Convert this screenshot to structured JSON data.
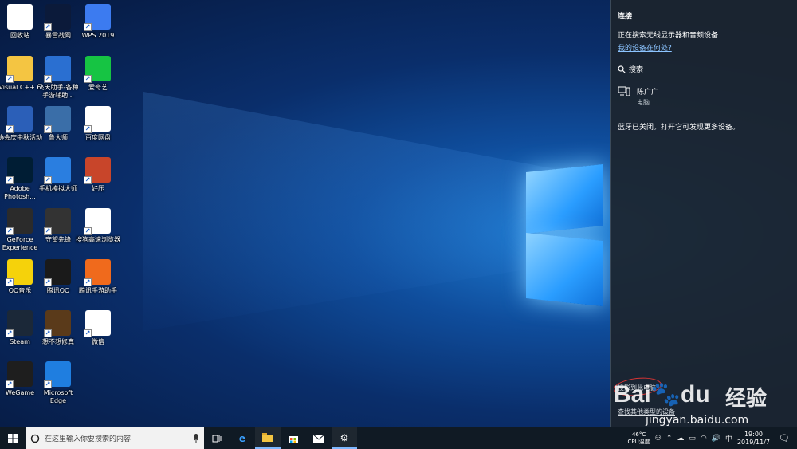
{
  "desktop": {
    "icons": [
      {
        "label": "回收站",
        "icon": "recycle-bin-icon",
        "color": "#ffffff"
      },
      {
        "label": "暴雪战网",
        "icon": "battlenet-icon",
        "color": "#0b1a3a"
      },
      {
        "label": "WPS 2019",
        "icon": "wps-icon",
        "color": "#3c7bf0"
      },
      {
        "label": "Visual C++ 6",
        "icon": "folder-icon",
        "color": "#f4c542"
      },
      {
        "label": "飞天助手-各种手游辅助...",
        "icon": "feitian-icon",
        "color": "#2a6fd1"
      },
      {
        "label": "爱奇艺",
        "icon": "iqiyi-icon",
        "color": "#16c443"
      },
      {
        "label": "协会庆中秋活动",
        "icon": "word-doc-icon",
        "color": "#2b5fb8"
      },
      {
        "label": "鲁大师",
        "icon": "ludashi-icon",
        "color": "#3a6ea8"
      },
      {
        "label": "百度网盘",
        "icon": "baidu-pan-icon",
        "color": "#ffffff"
      },
      {
        "label": "Adobe Photosh...",
        "icon": "photoshop-icon",
        "color": "#001d34"
      },
      {
        "label": "手机模拟大师",
        "icon": "phone-emulator-icon",
        "color": "#2a7ee0"
      },
      {
        "label": "好压",
        "icon": "haozip-icon",
        "color": "#c8452a"
      },
      {
        "label": "GeForce Experience",
        "icon": "geforce-icon",
        "color": "#2b2b2b"
      },
      {
        "label": "守望先锋",
        "icon": "overwatch-icon",
        "color": "#333333"
      },
      {
        "label": "搜狗高速浏览器",
        "icon": "sogou-browser-icon",
        "color": "#ffffff"
      },
      {
        "label": "QQ音乐",
        "icon": "qq-music-icon",
        "color": "#f5d20b"
      },
      {
        "label": "腾讯QQ",
        "icon": "qq-icon",
        "color": "#1a1a1a"
      },
      {
        "label": "腾讯手游助手",
        "icon": "tencent-game-helper-icon",
        "color": "#f06a1c"
      },
      {
        "label": "Steam",
        "icon": "steam-icon",
        "color": "#1b2838"
      },
      {
        "label": "想不想修真",
        "icon": "xiuzhen-icon",
        "color": "#5a3a1a"
      },
      {
        "label": "微信",
        "icon": "wechat-icon",
        "color": "#ffffff"
      },
      {
        "label": "WeGame",
        "icon": "wegame-icon",
        "color": "#1e1e1e"
      },
      {
        "label": "Microsoft Edge",
        "icon": "edge-icon",
        "color": "#1f7ee0"
      }
    ]
  },
  "panel": {
    "title": "连接",
    "status": "正在搜索无线显示器和音频设备",
    "where_link": "我的设备在何处?",
    "search_label": "搜索",
    "device": {
      "name": "陈广广",
      "type": "电脑"
    },
    "bluetooth_note": "蓝牙已关闭。打开它可发现更多设备。",
    "project_link": "投影到此电脑",
    "other_devices_link": "查找其他类型的设备"
  },
  "watermark": {
    "brand": "Bai",
    "brand2": "du",
    "jingyan": "经验",
    "url": "jingyan.baidu.com"
  },
  "taskbar": {
    "search_placeholder": "在这里输入你要搜索的内容",
    "apps": [
      "task-view-icon",
      "edge-icon",
      "file-explorer-icon",
      "store-icon",
      "mail-icon",
      "settings-icon"
    ],
    "tray": {
      "temp": "46°C",
      "temp_label": "CPU温度",
      "ime": "中",
      "time": "19:00",
      "date": "2019/11/7"
    }
  },
  "colors": {
    "accent": "#0078d7",
    "panel_bg": "#1c242c",
    "taskbar_bg": "#101a24",
    "link": "#8cc4ff"
  }
}
